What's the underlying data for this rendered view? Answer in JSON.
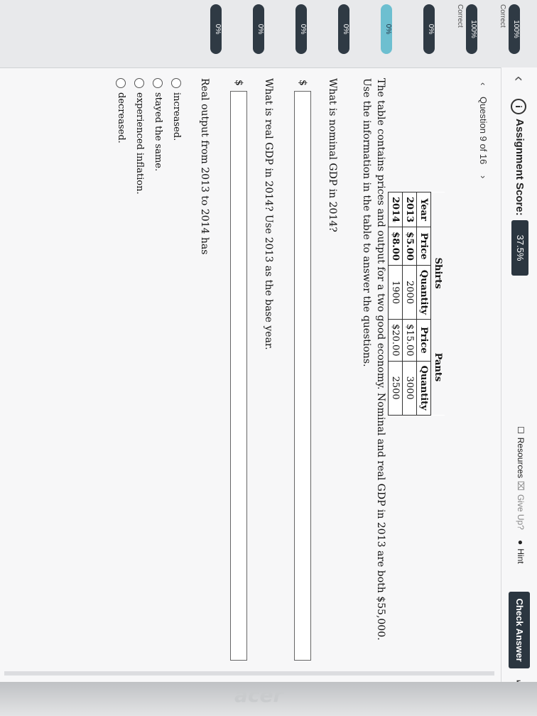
{
  "header": {
    "score_label": "Assignment Score:",
    "score_value": "37.5%",
    "resources": "Resources",
    "give_up": "Give Up?",
    "hint": "Hint",
    "check_answer": "Check Answer"
  },
  "rail": [
    {
      "pct": "100%",
      "label": "Correct"
    },
    {
      "pct": "100%",
      "label": "Correct"
    },
    {
      "pct": "0%",
      "label": ""
    },
    {
      "pct": "0%",
      "label": ""
    },
    {
      "pct": "0%",
      "label": ""
    },
    {
      "pct": "0%",
      "label": ""
    },
    {
      "pct": "0%",
      "label": ""
    },
    {
      "pct": "0%",
      "label": ""
    }
  ],
  "question": {
    "nav": "Question 9 of 16",
    "table": {
      "group1": "Shirts",
      "group2": "Pants",
      "col_year": "Year",
      "col_price": "Price",
      "col_qty": "Quantity",
      "rows": [
        {
          "year": "2013",
          "p1": "$5.00",
          "q1": "2000",
          "p2": "$15.00",
          "q2": "3000"
        },
        {
          "year": "2014",
          "p1": "$8.00",
          "q1": "1900",
          "p2": "$20.00",
          "q2": "2500"
        }
      ]
    },
    "stem": "The table contains prices and output for a two good economy. Nominal and real GDP in 2013 are both $55,000. Use the information in the table to answer the questions.",
    "q1": "What is nominal GDP in 2014?",
    "q2": "What is real GDP in 2014? Use 2013 as the base year.",
    "q3": "Real output from 2013 to 2014 has",
    "dollar": "$",
    "options": [
      "increased.",
      "stayed the same.",
      "experienced inflation.",
      "decreased."
    ]
  },
  "bezel_logo": "acer"
}
